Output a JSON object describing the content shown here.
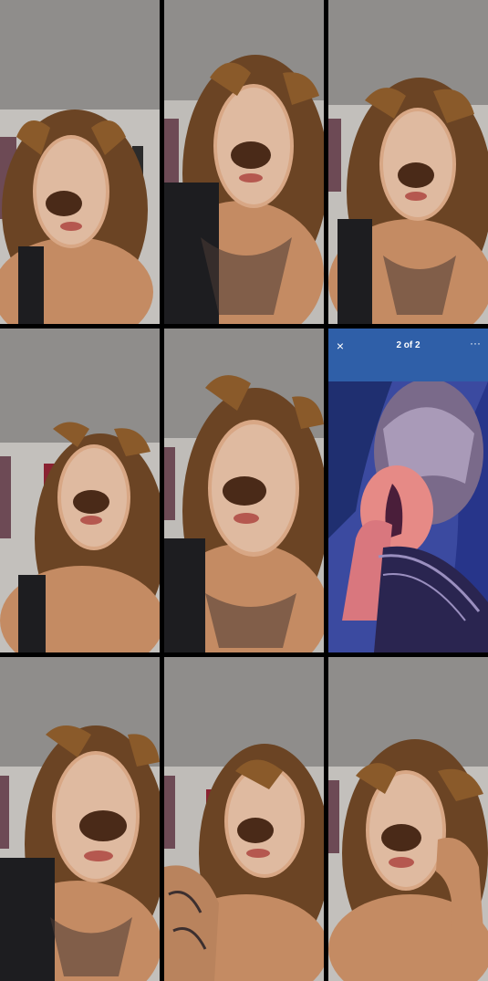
{
  "grid": {
    "tiles": [
      {
        "id": "t1",
        "kind": "selfie-filter",
        "filter": "dog-ears-freckles"
      },
      {
        "id": "t2",
        "kind": "selfie-filter",
        "filter": "dog-ears-freckles"
      },
      {
        "id": "t3",
        "kind": "selfie-filter",
        "filter": "dog-ears-freckles"
      },
      {
        "id": "t4",
        "kind": "selfie-filter",
        "filter": "dog-ears-freckles"
      },
      {
        "id": "t5",
        "kind": "selfie-filter",
        "filter": "dog-ears-freckles"
      },
      {
        "id": "t6",
        "kind": "story-viewer",
        "filter": "none"
      },
      {
        "id": "t7",
        "kind": "selfie-filter",
        "filter": "dog-ears-freckles"
      },
      {
        "id": "t8",
        "kind": "selfie-filter",
        "filter": "dog-ears-freckles"
      },
      {
        "id": "t9",
        "kind": "selfie-filter",
        "filter": "dog-ears-freckles"
      }
    ]
  },
  "story": {
    "close_icon": "×",
    "counter": "2 of 2",
    "more_icon": "···"
  },
  "colors": {
    "wall": "#bfbcb8",
    "ceiling": "#8f8d8b",
    "hair": "#6b4424",
    "skin": "#c48b63",
    "ears": "#8a5a2a",
    "ear_inner": "#d9a0a0",
    "nose": "#4a2a18",
    "story_bg": "#2f5fa8",
    "story_photo": "#3b4aa0"
  }
}
